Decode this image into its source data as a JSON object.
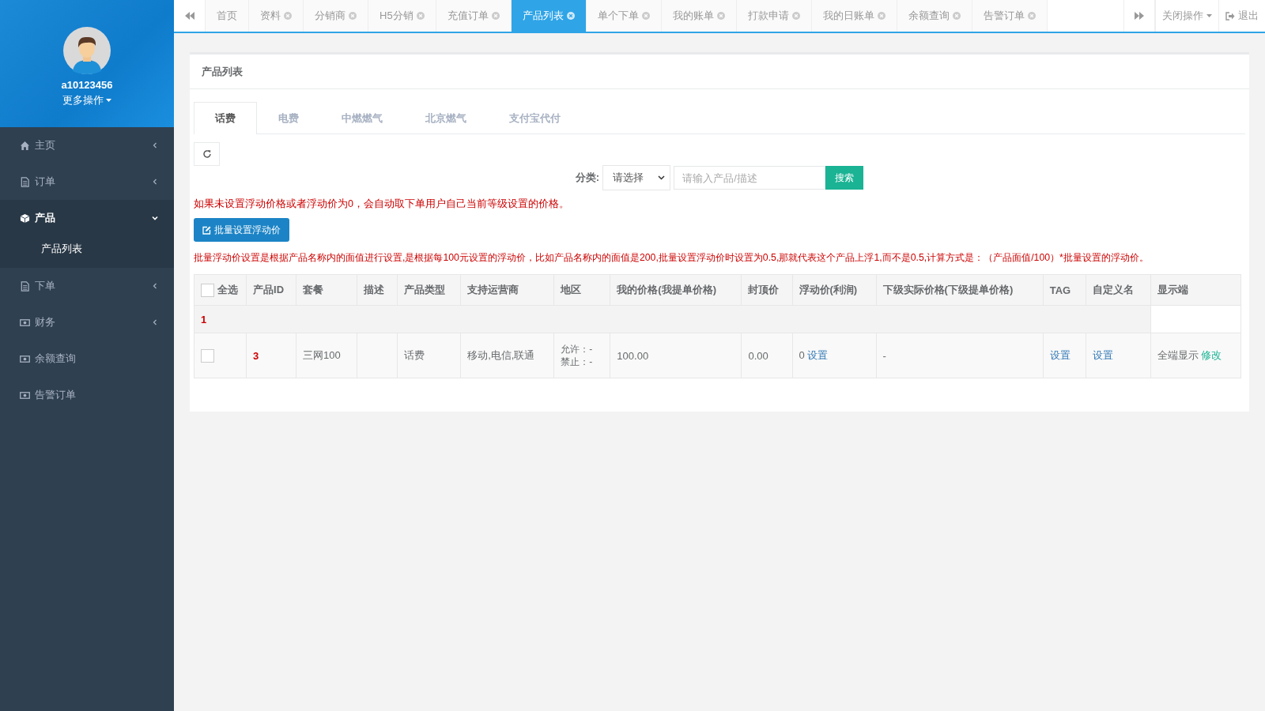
{
  "sidebar": {
    "user": {
      "name": "a10123456",
      "more": "更多操作"
    },
    "menu": [
      {
        "label": "主页",
        "kind": "home",
        "expanded": false,
        "selected": false
      },
      {
        "label": "订单",
        "kind": "file",
        "expanded": false,
        "selected": false
      },
      {
        "label": "产品",
        "kind": "cube",
        "expanded": true,
        "selected": true,
        "children": [
          {
            "label": "产品列表",
            "selected": true
          }
        ]
      },
      {
        "label": "下单",
        "kind": "file",
        "expanded": false,
        "selected": false
      },
      {
        "label": "财务",
        "kind": "money",
        "expanded": false,
        "selected": false
      },
      {
        "label": "余额查询",
        "kind": "money",
        "selected": false
      },
      {
        "label": "告警订单",
        "kind": "money",
        "selected": false
      }
    ]
  },
  "page_tabs": [
    {
      "label": "首页",
      "closable": false,
      "selected": false
    },
    {
      "label": "资料",
      "closable": true,
      "selected": false
    },
    {
      "label": "分销商",
      "closable": true,
      "selected": false
    },
    {
      "label": "H5分销",
      "closable": true,
      "selected": false
    },
    {
      "label": "充值订单",
      "closable": true,
      "selected": false
    },
    {
      "label": "产品列表",
      "closable": true,
      "selected": true
    },
    {
      "label": "单个下单",
      "closable": true,
      "selected": false
    },
    {
      "label": "我的账单",
      "closable": true,
      "selected": false
    },
    {
      "label": "打款申请",
      "closable": true,
      "selected": false
    },
    {
      "label": "我的日账单",
      "closable": true,
      "selected": false
    },
    {
      "label": "余额查询",
      "closable": true,
      "selected": false
    },
    {
      "label": "告警订单",
      "closable": true,
      "selected": false
    }
  ],
  "top_actions": {
    "close_menu": "关闭操作",
    "logout": "退出"
  },
  "panel": {
    "title": "产品列表",
    "tabs": [
      {
        "label": "话费",
        "selected": true
      },
      {
        "label": "电费",
        "selected": false
      },
      {
        "label": "中燃燃气",
        "selected": false
      },
      {
        "label": "北京燃气",
        "selected": false
      },
      {
        "label": "支付宝代付",
        "selected": false
      }
    ],
    "filter": {
      "label": "分类:",
      "select": "请选择",
      "placeholder": "请输入产品/描述",
      "button": "搜索"
    },
    "note_1": "如果未设置浮动价格或者浮动价为0，会自动取下单用户自己当前等级设置的价格。",
    "batch_button": "批量设置浮动价",
    "note_2": "批量浮动价设置是根据产品名称内的面值进行设置,是根据每100元设置的浮动价，比如产品名称内的面值是200,批量设置浮动价时设置为0.5,那就代表这个产品上浮1,而不是0.5,计算方式是：（产品面值/100）*批量设置的浮动价。",
    "table": {
      "select_all": {
        "label": "全选",
        "checked": false
      },
      "columns": [
        "产品ID",
        "套餐",
        "描述",
        "产品类型",
        "支持运营商",
        "地区",
        "我的价格(我提单价格)",
        "封顶价",
        "浮动价(利润)",
        "下级实际价格(下级提单价格)",
        "TAG",
        "自定义名",
        "显示端"
      ],
      "groups": [
        {
          "label": "1",
          "rows": [
            {
              "checked": false,
              "id": "3",
              "package": "三网100",
              "description": "",
              "type": "话费",
              "carriers": "移动,电信,联通",
              "region": [
                "允许：-",
                "禁止：-"
              ],
              "my_price": "100.00",
              "cap_price": "0.00",
              "float_price": "0",
              "float_link": "设置",
              "sub_price": "-",
              "tag_link": "设置",
              "custom_name_link": "设置",
              "display": "全端显示",
              "display_link": "修改"
            }
          ]
        }
      ]
    }
  }
}
